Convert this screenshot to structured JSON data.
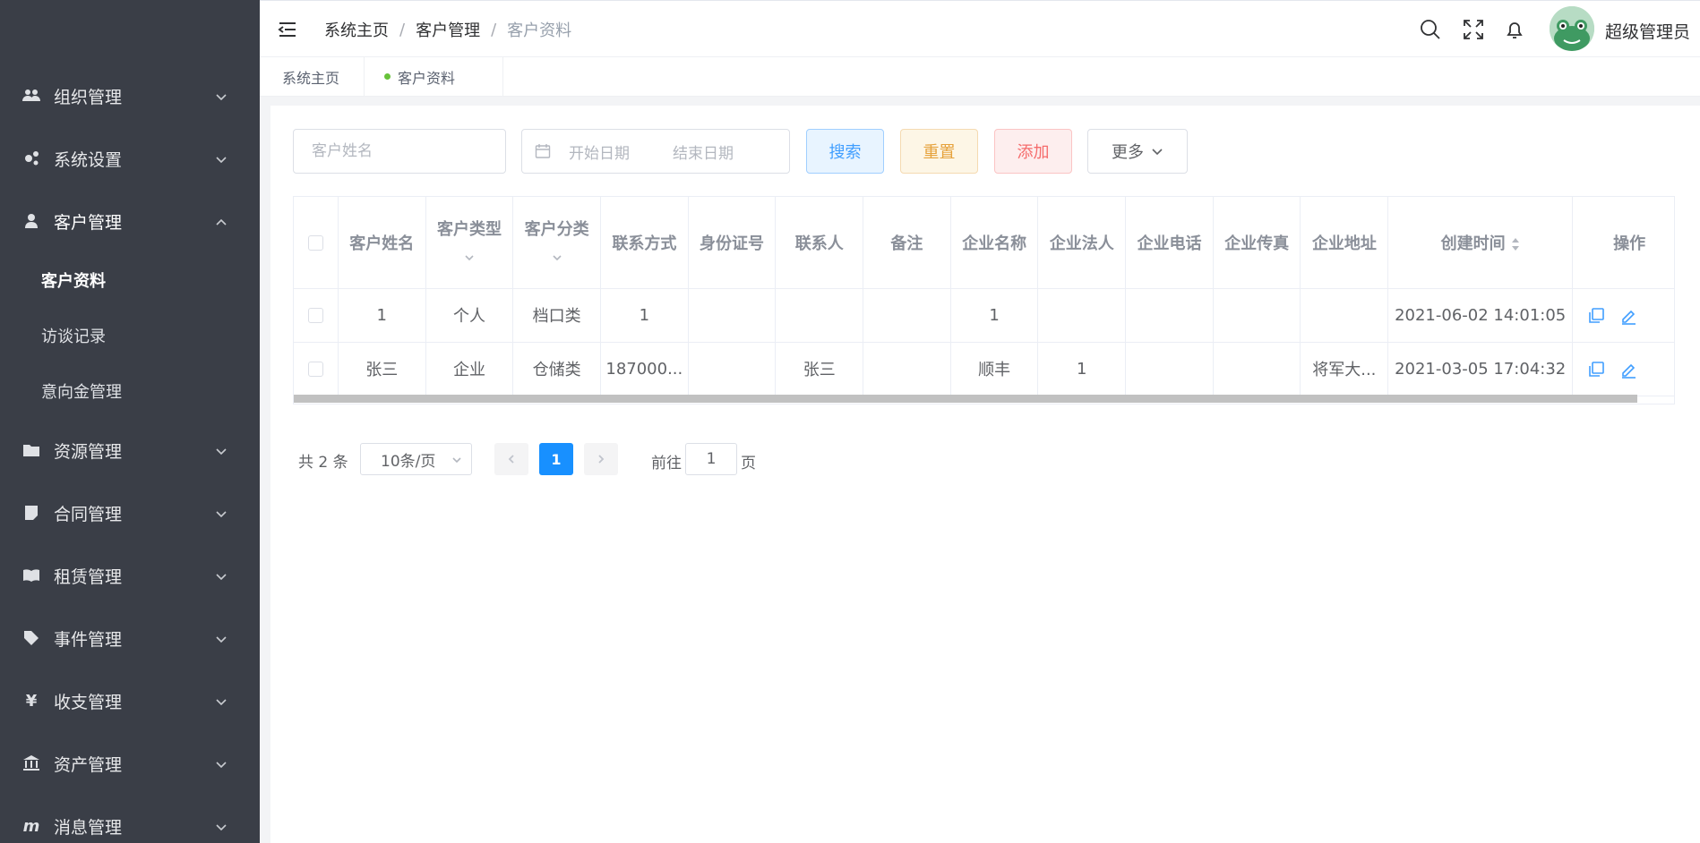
{
  "sidebar": {
    "items": [
      {
        "label": "组织管理",
        "icon": "users-icon",
        "open": false
      },
      {
        "label": "系统设置",
        "icon": "gears-icon",
        "open": false
      },
      {
        "label": "客户管理",
        "icon": "user-icon",
        "open": true,
        "children": [
          {
            "label": "客户资料",
            "active": true
          },
          {
            "label": "访谈记录",
            "active": false
          },
          {
            "label": "意向金管理",
            "active": false
          }
        ]
      },
      {
        "label": "资源管理",
        "icon": "folder-icon",
        "open": false
      },
      {
        "label": "合同管理",
        "icon": "note-icon",
        "open": false
      },
      {
        "label": "租赁管理",
        "icon": "book-icon",
        "open": false
      },
      {
        "label": "事件管理",
        "icon": "tag-icon",
        "open": false
      },
      {
        "label": "收支管理",
        "icon": "yen-icon",
        "open": false
      },
      {
        "label": "资产管理",
        "icon": "bank-icon",
        "open": false
      },
      {
        "label": "消息管理",
        "icon": "message-icon",
        "open": false
      }
    ]
  },
  "header": {
    "breadcrumb": [
      "系统主页",
      "客户管理",
      "客户资料"
    ],
    "user_name": "超级管理员"
  },
  "tags": [
    {
      "label": "系统主页",
      "active": false
    },
    {
      "label": "客户资料",
      "active": true
    }
  ],
  "filters": {
    "name_placeholder": "客户姓名",
    "start_date_placeholder": "开始日期",
    "end_date_placeholder": "结束日期",
    "search_label": "搜索",
    "reset_label": "重置",
    "add_label": "添加",
    "more_label": "更多"
  },
  "table": {
    "columns": [
      "客户姓名",
      "客户类型",
      "客户分类",
      "联系方式",
      "身份证号",
      "联系人",
      "备注",
      "企业名称",
      "企业法人",
      "企业电话",
      "企业传真",
      "企业地址",
      "创建时间",
      "操作"
    ],
    "rows": [
      [
        "1",
        "个人",
        "档口类",
        "1",
        "",
        "",
        "",
        "1",
        "",
        "",
        "",
        "",
        "2021-06-02 14:01:05"
      ],
      [
        "张三",
        "企业",
        "仓储类",
        "187000...",
        "",
        "张三",
        "",
        "顺丰",
        "1",
        "",
        "",
        "将军大...",
        "2021-03-05 17:04:32"
      ]
    ]
  },
  "pagination": {
    "total_text": "共 2 条",
    "page_size": "10条/页",
    "current_page": "1",
    "goto_label": "前往",
    "goto_value": "1",
    "page_suffix": "页"
  },
  "colors": {
    "sidebar_bg": "#3a3e47",
    "primary": "#1890ff",
    "search": "#409eff",
    "reset": "#e6a23c",
    "add": "#f56c6c"
  }
}
